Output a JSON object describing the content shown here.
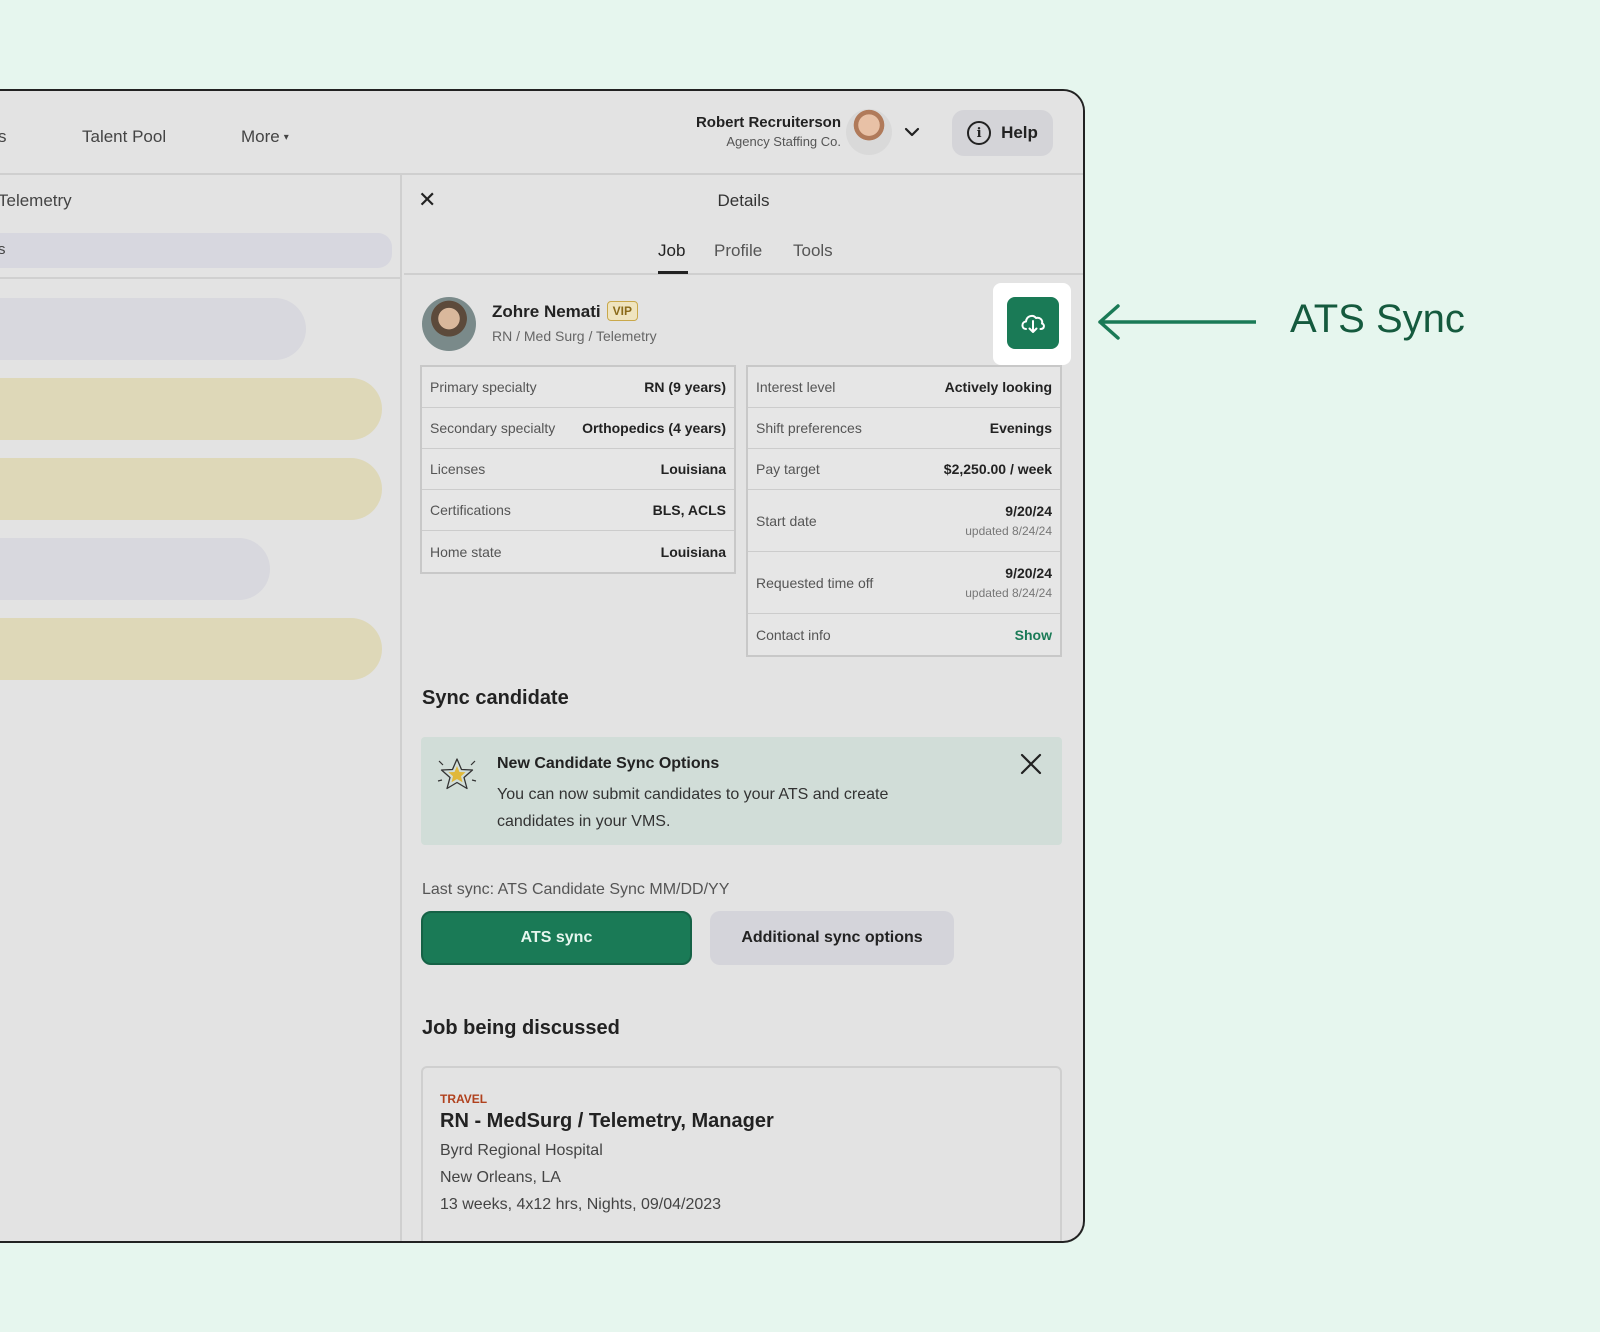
{
  "nav": {
    "partial_item": "s",
    "talent_pool": "Talent Pool",
    "more": "More",
    "more_caret": "▾",
    "user_name": "Robert Recruiterson",
    "user_company": "Agency Staffing Co.",
    "help": "Help",
    "help_icon": "info-icon"
  },
  "left_panel": {
    "title_partial": "Telemetry",
    "search_partial": "s"
  },
  "details": {
    "title": "Details",
    "close": "✕",
    "tabs": [
      "Job",
      "Profile",
      "Tools"
    ],
    "active_tab": "Job",
    "candidate": {
      "name": "Zohre Nemati",
      "badge": "VIP",
      "role": "RN / Med Surg / Telemetry"
    },
    "left_table": [
      {
        "key": "Primary specialty",
        "value": "RN (9 years)"
      },
      {
        "key": "Secondary specialty",
        "value": "Orthopedics (4 years)"
      },
      {
        "key": "Licenses",
        "value": "Louisiana"
      },
      {
        "key": "Certifications",
        "value": "BLS, ACLS"
      },
      {
        "key": "Home state",
        "value": "Louisiana"
      }
    ],
    "right_table": [
      {
        "key": "Interest level",
        "value": "Actively looking"
      },
      {
        "key": "Shift preferences",
        "value": "Evenings"
      },
      {
        "key": "Pay target",
        "value": "$2,250.00 / week"
      },
      {
        "key": "Start date",
        "value": "9/20/24",
        "sub": "updated 8/24/24"
      },
      {
        "key": "Requested time off",
        "value": "9/20/24",
        "sub": "updated 8/24/24"
      },
      {
        "key": "Contact info",
        "value": "Show"
      }
    ],
    "sync": {
      "section_title": "Sync candidate",
      "banner_title": "New Candidate Sync Options",
      "banner_text": "You can now submit candidates to your ATS and create candidates in your VMS.",
      "last_sync": "Last sync: ATS Candidate Sync MM/DD/YY",
      "primary_button": "ATS sync",
      "secondary_button": "Additional sync options"
    },
    "job": {
      "section_title": "Job being discussed",
      "tag": "TRAVEL",
      "title": "RN - MedSurg / Telemetry, Manager",
      "facility": "Byrd Regional Hospital",
      "location": "New Orleans, LA",
      "schedule": "13 weeks, 4x12 hrs, Nights, 09/04/2023"
    }
  },
  "annotation": {
    "label": "ATS Sync"
  },
  "colors": {
    "page_background": "#e6f6ee",
    "accent_green": "#1a7a56",
    "vip_gold": "#c9a84a",
    "travel_tag": "#b0411d"
  }
}
